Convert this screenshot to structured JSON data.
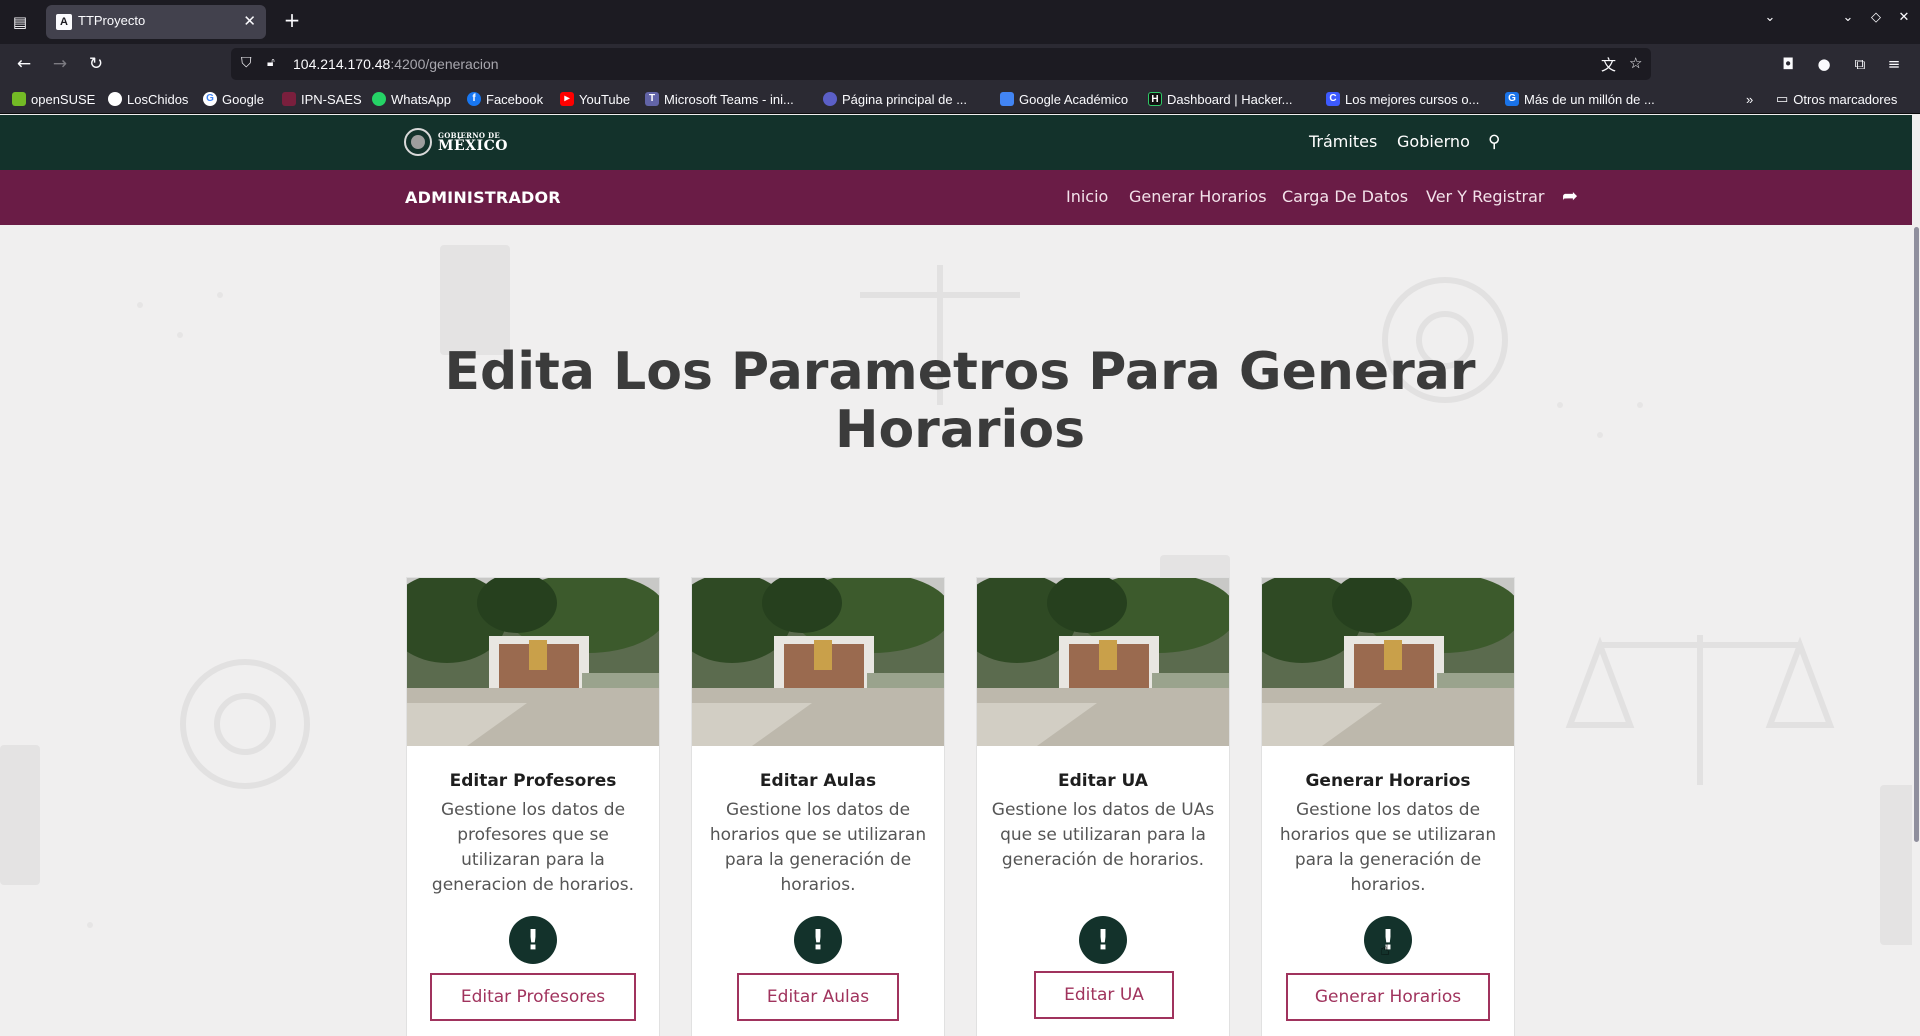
{
  "browser": {
    "tab_title": "TTProyecto",
    "tab_favicon": "A",
    "url_host": "104.214.170.48",
    "url_rest": ":4200/generacion",
    "bookmarks": [
      {
        "label": "openSUSE",
        "color": "#73ba25",
        "icon": "opensuse-icon"
      },
      {
        "label": "LosChidos",
        "color": "#ffffff",
        "icon": "github-icon"
      },
      {
        "label": "Google",
        "color": "#4285f4",
        "icon": "google-icon"
      },
      {
        "label": "IPN-SAES",
        "color": "#7a1f3d",
        "icon": "ipn-icon"
      },
      {
        "label": "WhatsApp",
        "color": "#25d366",
        "icon": "whatsapp-icon"
      },
      {
        "label": "Facebook",
        "color": "#1877f2",
        "icon": "facebook-icon"
      },
      {
        "label": "YouTube",
        "color": "#ff0000",
        "icon": "youtube-icon"
      },
      {
        "label": "Microsoft Teams - ini...",
        "color": "#6264a7",
        "icon": "teams-icon"
      },
      {
        "label": "Página principal de ...",
        "color": "#5b5fc7",
        "icon": "copilot-icon"
      },
      {
        "label": "Google Académico",
        "color": "#4285f4",
        "icon": "scholar-icon"
      },
      {
        "label": "Dashboard | Hacker...",
        "color": "#111111",
        "icon": "hackerrank-icon"
      },
      {
        "label": "Los mejores cursos o...",
        "color": "#3d5afe",
        "icon": "coursera-icon"
      },
      {
        "label": "Más de un millón de ...",
        "color": "#1a73e8",
        "icon": "books-icon"
      }
    ],
    "other_bookmarks": "Otros marcadores"
  },
  "gob_header": {
    "logo_small": "GOBIERNO DE",
    "logo_big": "MÉXICO",
    "links": [
      "Trámites",
      "Gobierno"
    ]
  },
  "sub_header": {
    "brand": "ADMINISTRADOR",
    "links": [
      "Inicio",
      "Generar Horarios",
      "Carga De Datos",
      "Ver Y Registrar"
    ]
  },
  "main": {
    "title": "Edita Los Parametros Para Generar Horarios",
    "cards": [
      {
        "title": "Editar Profesores",
        "text": "Gestione los datos de profesores que se utilizaran para la generacion de horarios.",
        "alert": "!",
        "button": "Editar Profesores"
      },
      {
        "title": "Editar Aulas",
        "text": "Gestione los datos de horarios que se utilizaran para la generación de horarios.",
        "alert": "!",
        "button": "Editar Aulas"
      },
      {
        "title": "Editar UA",
        "text": "Gestione los datos de UAs que se utilizaran para la generación de horarios.",
        "alert": "!",
        "button": "Editar UA"
      },
      {
        "title": "Generar Horarios",
        "text": "Gestione los datos de horarios que se utilizaran para la generación de horarios.",
        "alert": "!",
        "button": "Generar Horarios"
      }
    ]
  },
  "colors": {
    "gob_green": "#13322b",
    "gob_wine": "#6a1c46",
    "button_accent": "#a0335d"
  }
}
